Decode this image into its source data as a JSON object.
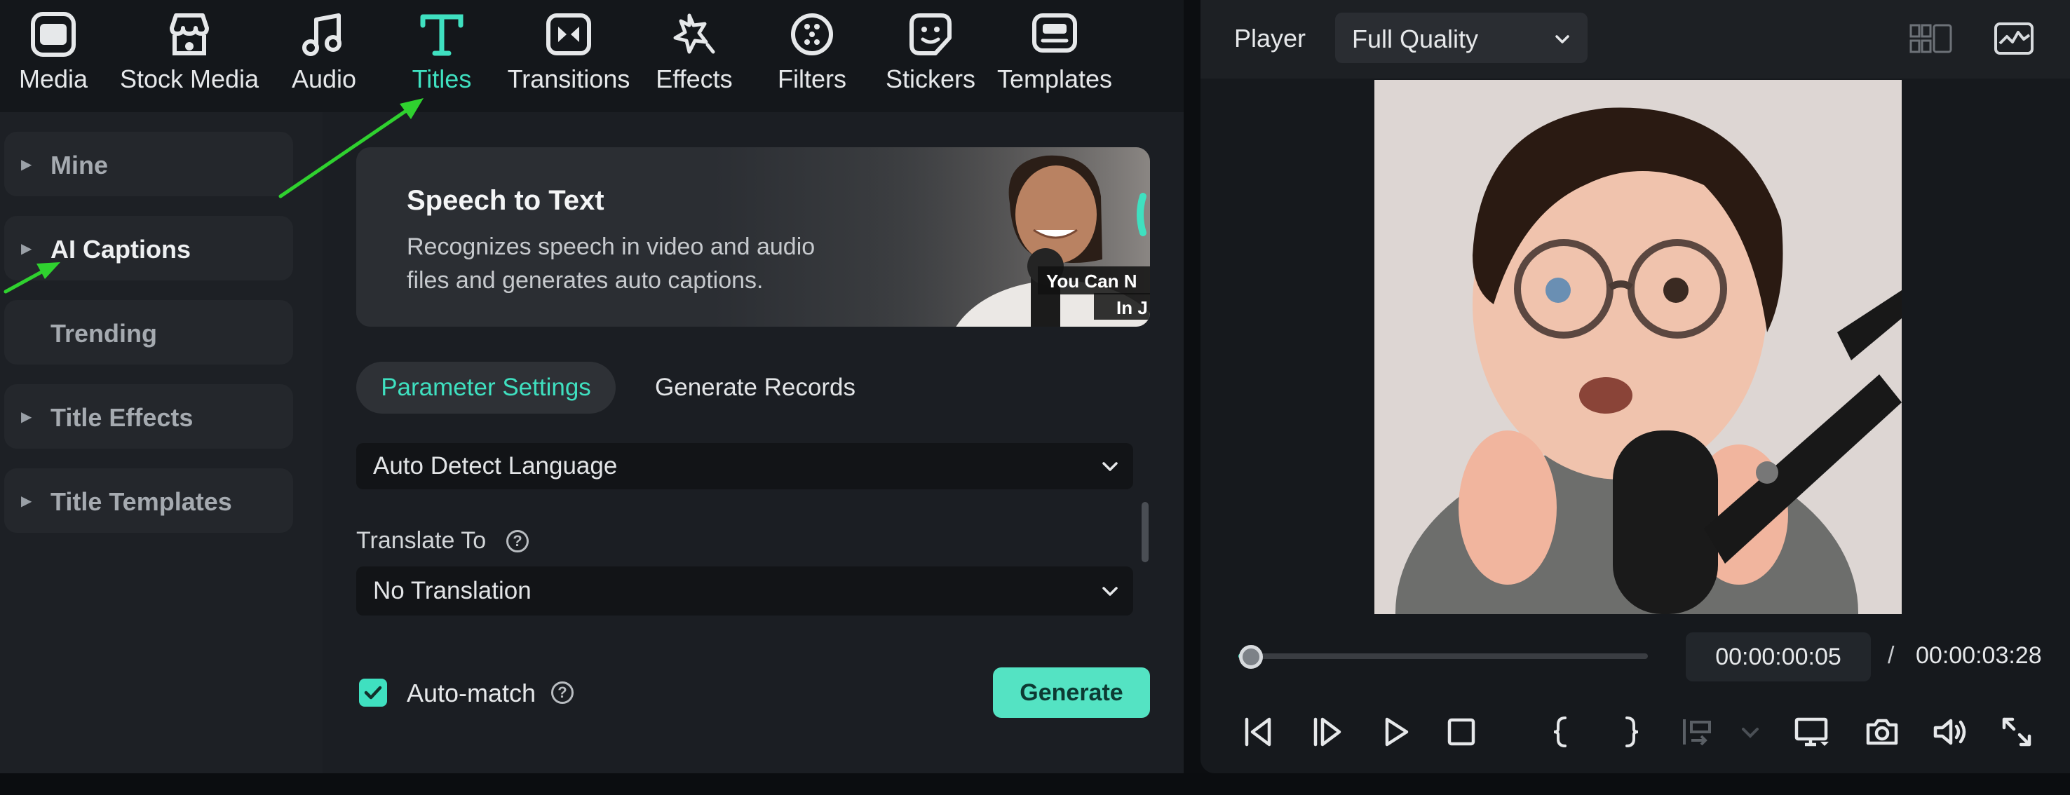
{
  "toolbar": {
    "items": [
      {
        "label": "Media",
        "icon": "media-icon"
      },
      {
        "label": "Stock Media",
        "icon": "stock-media-icon"
      },
      {
        "label": "Audio",
        "icon": "audio-icon"
      },
      {
        "label": "Titles",
        "icon": "titles-icon",
        "active": true
      },
      {
        "label": "Transitions",
        "icon": "transitions-icon"
      },
      {
        "label": "Effects",
        "icon": "effects-icon"
      },
      {
        "label": "Filters",
        "icon": "filters-icon"
      },
      {
        "label": "Stickers",
        "icon": "stickers-icon"
      },
      {
        "label": "Templates",
        "icon": "templates-icon"
      }
    ]
  },
  "sidebar": {
    "items": [
      {
        "label": "Mine",
        "expandable": true
      },
      {
        "label": "AI Captions",
        "expandable": true,
        "selected": true
      },
      {
        "label": "Trending",
        "expandable": false
      },
      {
        "label": "Title Effects",
        "expandable": true
      },
      {
        "label": "Title Templates",
        "expandable": true
      }
    ]
  },
  "banner": {
    "title": "Speech to Text",
    "description": "Recognizes speech in video and audio files and generates auto captions.",
    "image_caption_line1": "You Can N",
    "image_caption_line2": "In J"
  },
  "tabs": {
    "parameter_settings": "Parameter Settings",
    "generate_records": "Generate Records"
  },
  "settings": {
    "language_value": "Auto Detect Language",
    "translate_label": "Translate To",
    "translate_value": "No Translation",
    "automatch_label": "Auto-match",
    "automatch_checked": true,
    "generate_label": "Generate"
  },
  "player": {
    "label": "Player",
    "quality": "Full Quality",
    "time_current": "00:00:00:05",
    "time_separator": "/",
    "time_total": "00:00:03:28",
    "progress": 0.03
  },
  "colors": {
    "accent": "#3fe0c0",
    "generate_bg": "#54e3c3",
    "annotation_arrow": "#2fd12f"
  }
}
